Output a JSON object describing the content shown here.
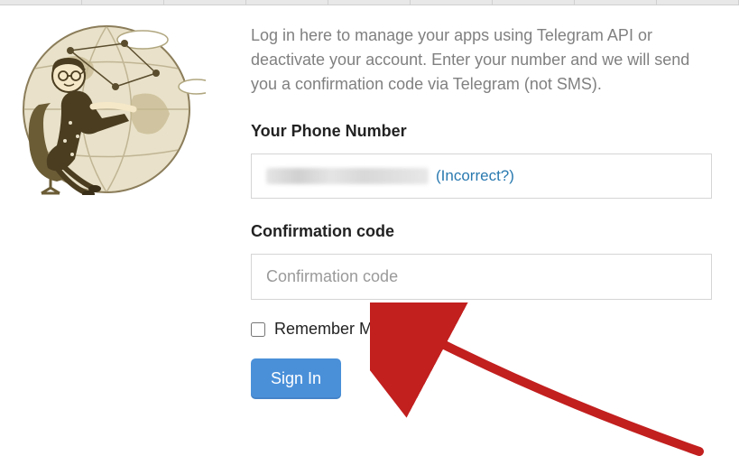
{
  "intro_text": "Log in here to manage your apps using Telegram API or deactivate your account. Enter your number and we will send you a confirmation code via Telegram (not SMS).",
  "phone": {
    "label": "Your Phone Number",
    "incorrect_link": "(Incorrect?)"
  },
  "code": {
    "label": "Confirmation code",
    "placeholder": "Confirmation code"
  },
  "remember_label": "Remember Me",
  "signin_label": "Sign In",
  "colors": {
    "link": "#2a7ab0",
    "button": "#4a90d9"
  }
}
